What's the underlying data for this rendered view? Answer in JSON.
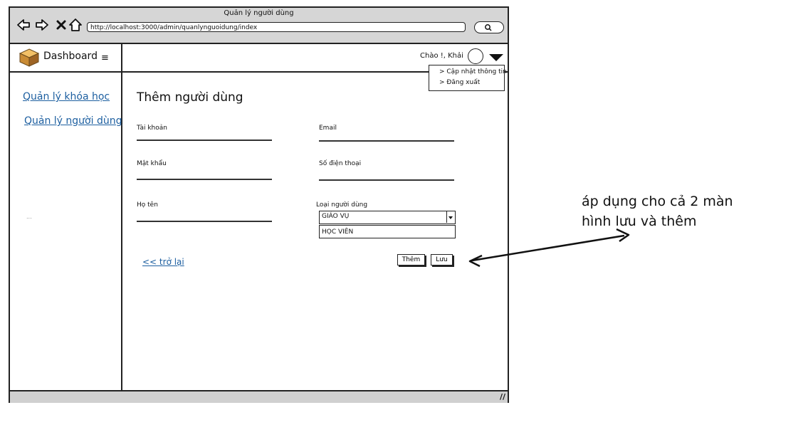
{
  "browser": {
    "window_title": "Quản lý người dùng",
    "url": "http://localhost:3000/admin/quanlynguoidung/index",
    "nav_icons": [
      "back-arrow-icon",
      "forward-arrow-icon",
      "close-x-icon",
      "home-icon"
    ],
    "search_icon": "search-icon"
  },
  "sidebar": {
    "brand": "Dashboard",
    "links": [
      "Quản lý khóa học",
      "Quản lý người dùng"
    ],
    "footnote": "..."
  },
  "header": {
    "greeting": "Chào !, Khải",
    "menu": [
      "> Cập nhật thông tin",
      "> Đăng xuất"
    ]
  },
  "form": {
    "title": "Thêm người dùng",
    "fields": {
      "account": "Tài khoản",
      "email": "Email",
      "password": "Mật khẩu",
      "phone": "Số điện thoại",
      "fullname": "Họ tên",
      "user_type": "Loại người dùng"
    },
    "user_type_selected": "GIÁO VỤ",
    "user_type_option": "HỌC VIÊN",
    "back": "<< trở lại",
    "add_button": "Thêm",
    "save_button": "Lưu"
  },
  "annotation": "áp dụng cho cả 2 màn hình lưu và thêm",
  "colors": {
    "link": "#1d5fa0",
    "chrome": "#d6d6d6"
  }
}
